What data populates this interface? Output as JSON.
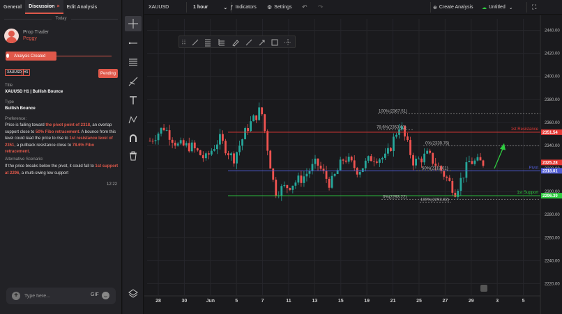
{
  "tabs": {
    "general": "General",
    "discussion": "Discussion",
    "discussion_close": "×",
    "edit": "Edit Analysis"
  },
  "today": "Today",
  "author": {
    "role": "Prop Trader",
    "name": "Peggy"
  },
  "event": "Analysis Created",
  "badges": {
    "symbol": "XAUUSD",
    "timeframe": "H1",
    "status": "Pending"
  },
  "labels": {
    "title": "Title",
    "type": "Type",
    "preference": "Preference:",
    "alternative": "Alternative Scenario:"
  },
  "title_value": "XAUUSD H1 | Bullish Bounce",
  "type_value": "Bullish Bounce",
  "preference": {
    "p1": "Price is failing toward ",
    "h1": "the pivot point of 2318",
    "p2": ", an overlap support close to ",
    "h2": "50% Fibo retracement",
    "p3": ". A bounce from this level could lead the price to rise to ",
    "h3": "1st resistance level of 2351",
    "p4": ", a pullback resistance close to ",
    "h4": "78.6% Fibo retracement",
    "p5": "."
  },
  "alternative": {
    "p1": "If the price breaks below the pivot, it could fall  to ",
    "h1": "1st support at 2296",
    "p2": ", a multi-swing low  support"
  },
  "time": "12:22",
  "composer": {
    "placeholder": "Type here...",
    "gif": "GIF"
  },
  "topbar": {
    "symbol": "XAUUSD",
    "interval": "1 hour",
    "indicators": "Indicators",
    "settings": "Settings",
    "create": "Create Analysis",
    "untitled": "Untitled"
  },
  "colors": {
    "accent": "#e0584a",
    "up": "#26a69a",
    "down": "#ef5350",
    "resistance": "#e53935",
    "pivot": "#4f5bd5",
    "support": "#2ecc40"
  },
  "chart_data": {
    "type": "candlestick",
    "yaxis": {
      "min": 2210,
      "max": 2450,
      "ticks": [
        "2440.00",
        "2420.00",
        "2400.00",
        "2380.00",
        "2360.00",
        "2340.00",
        "2320.00",
        "2300.00",
        "2280.00",
        "2260.00",
        "2240.00",
        "2220.00"
      ]
    },
    "xaxis": {
      "ticks": [
        "28",
        "30",
        "Jun",
        "5",
        "7",
        "11",
        "13",
        "15",
        "19",
        "21",
        "25",
        "27",
        "29",
        "3",
        "5"
      ]
    },
    "series": [
      {
        "date": "May 27",
        "close": 2344
      },
      {
        "date": "May 28",
        "close": 2356
      },
      {
        "date": "May 29",
        "close": 2340
      },
      {
        "date": "May 30",
        "close": 2339
      },
      {
        "date": "May 31",
        "close": 2328
      },
      {
        "date": "Jun 3",
        "close": 2346
      },
      {
        "date": "Jun 4",
        "close": 2328
      },
      {
        "date": "Jun 5",
        "close": 2355
      },
      {
        "date": "Jun 6",
        "close": 2372
      },
      {
        "date": "Jun 7",
        "close": 2300
      },
      {
        "date": "Jun 10",
        "close": 2305
      },
      {
        "date": "Jun 11",
        "close": 2312
      },
      {
        "date": "Jun 12",
        "close": 2325
      },
      {
        "date": "Jun 13",
        "close": 2306
      },
      {
        "date": "Jun 14",
        "close": 2330
      },
      {
        "date": "Jun 17",
        "close": 2318
      },
      {
        "date": "Jun 18",
        "close": 2330
      },
      {
        "date": "Jun 19",
        "close": 2329
      },
      {
        "date": "Jun 20",
        "close": 2359
      },
      {
        "date": "Jun 21",
        "close": 2325
      },
      {
        "date": "Jun 24",
        "close": 2332
      },
      {
        "date": "Jun 25",
        "close": 2318
      },
      {
        "date": "Jun 26",
        "close": 2300
      },
      {
        "date": "Jun 27",
        "close": 2326
      },
      {
        "date": "Jun 28",
        "close": 2325
      }
    ],
    "levels": [
      {
        "name": "1st Resistance",
        "price": 2351.54,
        "price_label": "2351.54",
        "color": "#e53935"
      },
      {
        "name": "Pivot",
        "price": 2318.01,
        "price_label": "2318.01",
        "color": "#4f5bd5"
      },
      {
        "name": "1st Support",
        "price": 2296.39,
        "price_label": "2296.39",
        "color": "#2ecc40"
      }
    ],
    "current_price": {
      "price": 2325.28,
      "label": "2325.28"
    },
    "fib_labels": [
      "100%(2367.51)",
      "78.6%(2353.61)",
      "0%(2339.76)",
      "50%(2318.01)",
      "0%(2293.22)",
      "100%(2293.82)"
    ]
  }
}
